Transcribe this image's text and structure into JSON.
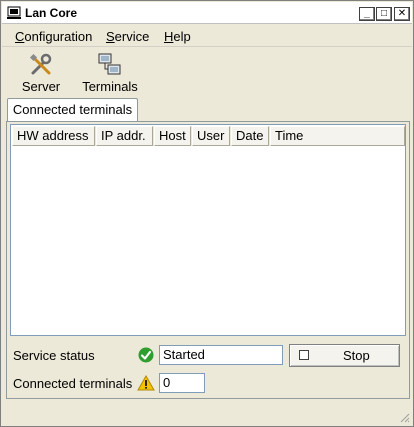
{
  "window": {
    "title": "Lan Core",
    "app_icon": "computer-icon",
    "controls": {
      "minimize": "_",
      "maximize": "□",
      "close": "✕"
    }
  },
  "menubar": {
    "items": [
      {
        "mnemonic": "C",
        "rest": "onfiguration"
      },
      {
        "mnemonic": "S",
        "rest": "ervice"
      },
      {
        "mnemonic": "H",
        "rest": "elp"
      }
    ]
  },
  "toolbar": {
    "server": {
      "label": "Server",
      "icon": "tools-icon"
    },
    "terminals": {
      "label": "Terminals",
      "icon": "terminals-icon"
    }
  },
  "tabs": [
    {
      "label": "Connected terminals",
      "active": true
    }
  ],
  "terminals_table": {
    "columns": [
      "HW address",
      "IP addr.",
      "Host",
      "User",
      "Date",
      "Time"
    ],
    "rows": []
  },
  "service": {
    "status_label": "Service status",
    "status_value": "Started",
    "status_icon": "check-circle-icon",
    "status_color": "#2e9e2e",
    "stop_label": "Stop"
  },
  "connected": {
    "label": "Connected terminals",
    "count": "0",
    "icon": "warning-icon",
    "icon_color": "#f5c400"
  }
}
